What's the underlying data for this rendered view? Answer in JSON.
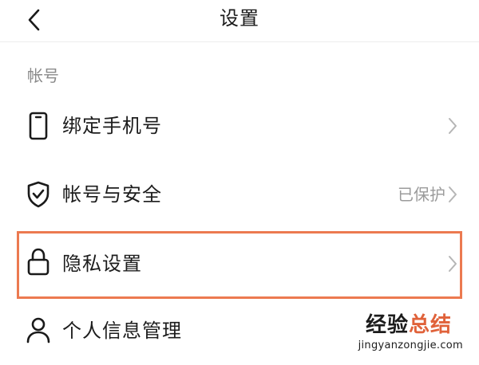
{
  "header": {
    "title": "设置",
    "back_icon": "chevron-left-icon"
  },
  "section": {
    "label": "帐号"
  },
  "rows": [
    {
      "label": "绑定手机号",
      "value": "",
      "icon": "phone-icon"
    },
    {
      "label": "帐号与安全",
      "value": "已保护",
      "icon": "shield-check-icon"
    },
    {
      "label": "隐私设置",
      "value": "",
      "icon": "lock-icon"
    },
    {
      "label": "个人信息管理",
      "value": "",
      "icon": "person-icon"
    }
  ],
  "highlight": {
    "target": "隐私设置",
    "color": "#ec7a50"
  },
  "watermark": {
    "main": "经验",
    "accent": "总结",
    "sub": "jingyanzongjie.com",
    "accent_color": "#e0623a"
  }
}
